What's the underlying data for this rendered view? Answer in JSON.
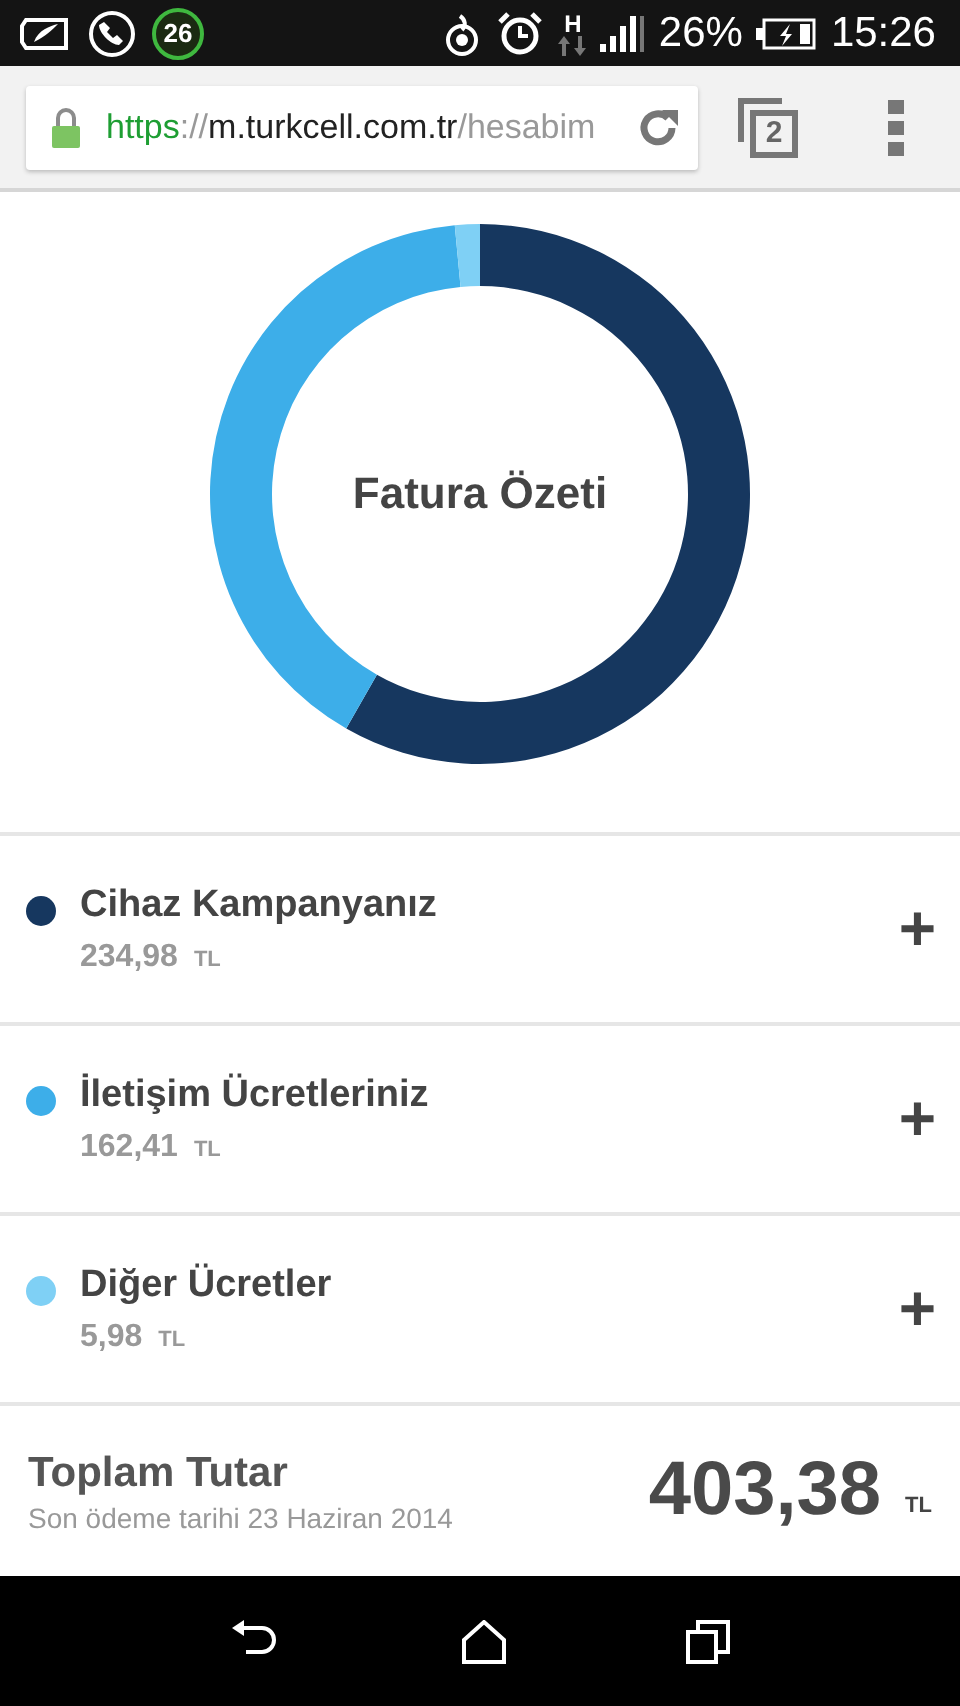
{
  "status_bar": {
    "badge": "26",
    "network": "H",
    "battery": "26%",
    "time": "15:26"
  },
  "browser": {
    "url_scheme": "https",
    "url_separator": "://",
    "url_host": "m.turkcell.com.tr",
    "url_path": "/hesabim",
    "tab_count": "2"
  },
  "chart": {
    "chart_data": {
      "type": "donut",
      "title": "Fatura Özeti",
      "values": [
        58.25,
        40.26,
        1.49
      ]
    }
  },
  "items": [
    {
      "name": "Cihaz Kampanyanız",
      "amount": "234,98",
      "currency": "TL",
      "color": "#16375f",
      "expand": "+"
    },
    {
      "name": "İletişim Ücretleriniz",
      "amount": "162,41",
      "currency": "TL",
      "color": "#3daee9",
      "expand": "+"
    },
    {
      "name": "Diğer Ücretler",
      "amount": "5,98",
      "currency": "TL",
      "color": "#7fd0f5",
      "expand": "+"
    }
  ],
  "total": {
    "label": "Toplam Tutar",
    "due": "Son ödeme tarihi 23 Haziran 2014",
    "amount": "403,38",
    "currency": "TL"
  }
}
